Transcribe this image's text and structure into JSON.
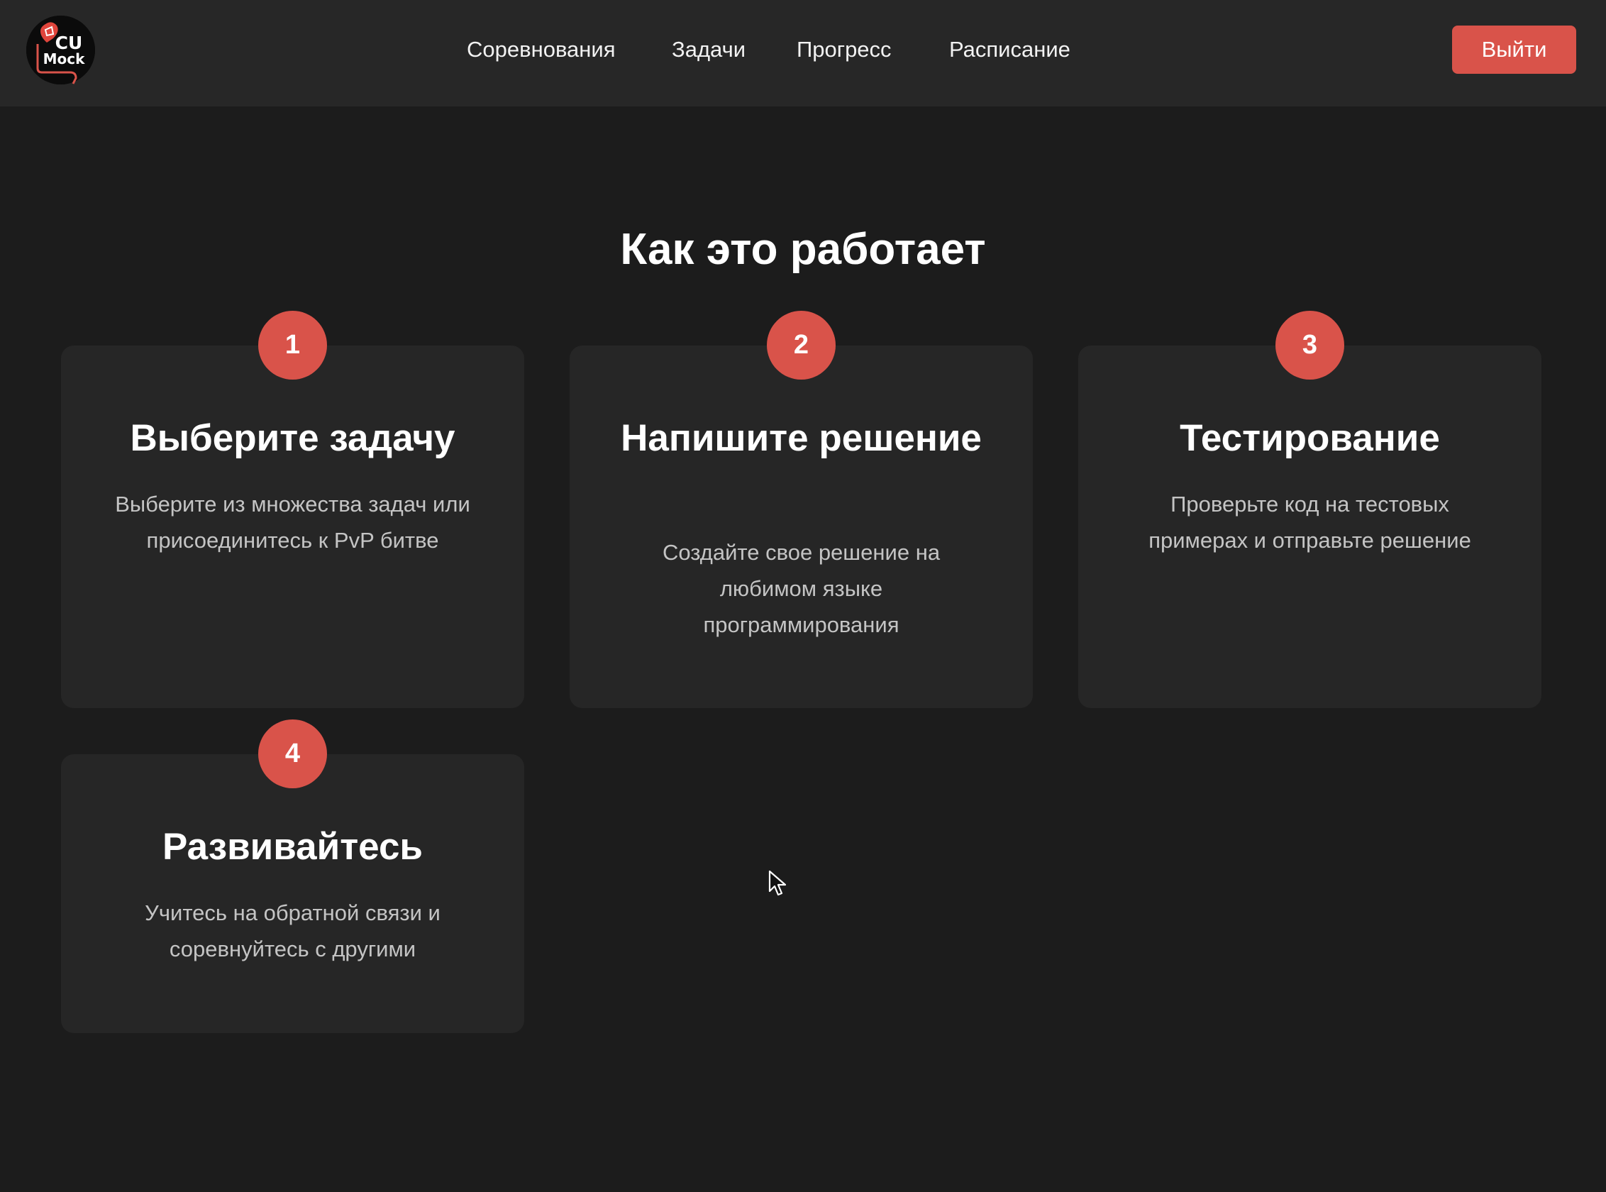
{
  "header": {
    "logo": {
      "line1": "CU",
      "line2": "Mock",
      "icon": "cu-mock-logo-icon"
    },
    "nav": [
      {
        "label": "Соревнования"
      },
      {
        "label": "Задачи"
      },
      {
        "label": "Прогресс"
      },
      {
        "label": "Расписание"
      }
    ],
    "logout_label": "Выйти"
  },
  "section": {
    "title": "Как это работает",
    "steps": [
      {
        "number": "1",
        "title": "Выберите задачу",
        "description": "Выберите из множества задач или присоединитесь к PvP битве"
      },
      {
        "number": "2",
        "title": "Напишите решение",
        "description": "Создайте свое решение на любимом языке программирования"
      },
      {
        "number": "3",
        "title": "Тестирование",
        "description": "Проверьте код на тестовых примерах и отправьте решение"
      },
      {
        "number": "4",
        "title": "Развивайтесь",
        "description": "Учитесь на обратной связи и соревнуйтесь с другими"
      }
    ]
  },
  "colors": {
    "accent": "#d9534a",
    "background": "#1c1c1c",
    "header_background": "#272727",
    "card_background": "#262626",
    "muted_text": "#c4c4c4"
  },
  "icons": {
    "cursor": "mouse-pointer-icon"
  }
}
